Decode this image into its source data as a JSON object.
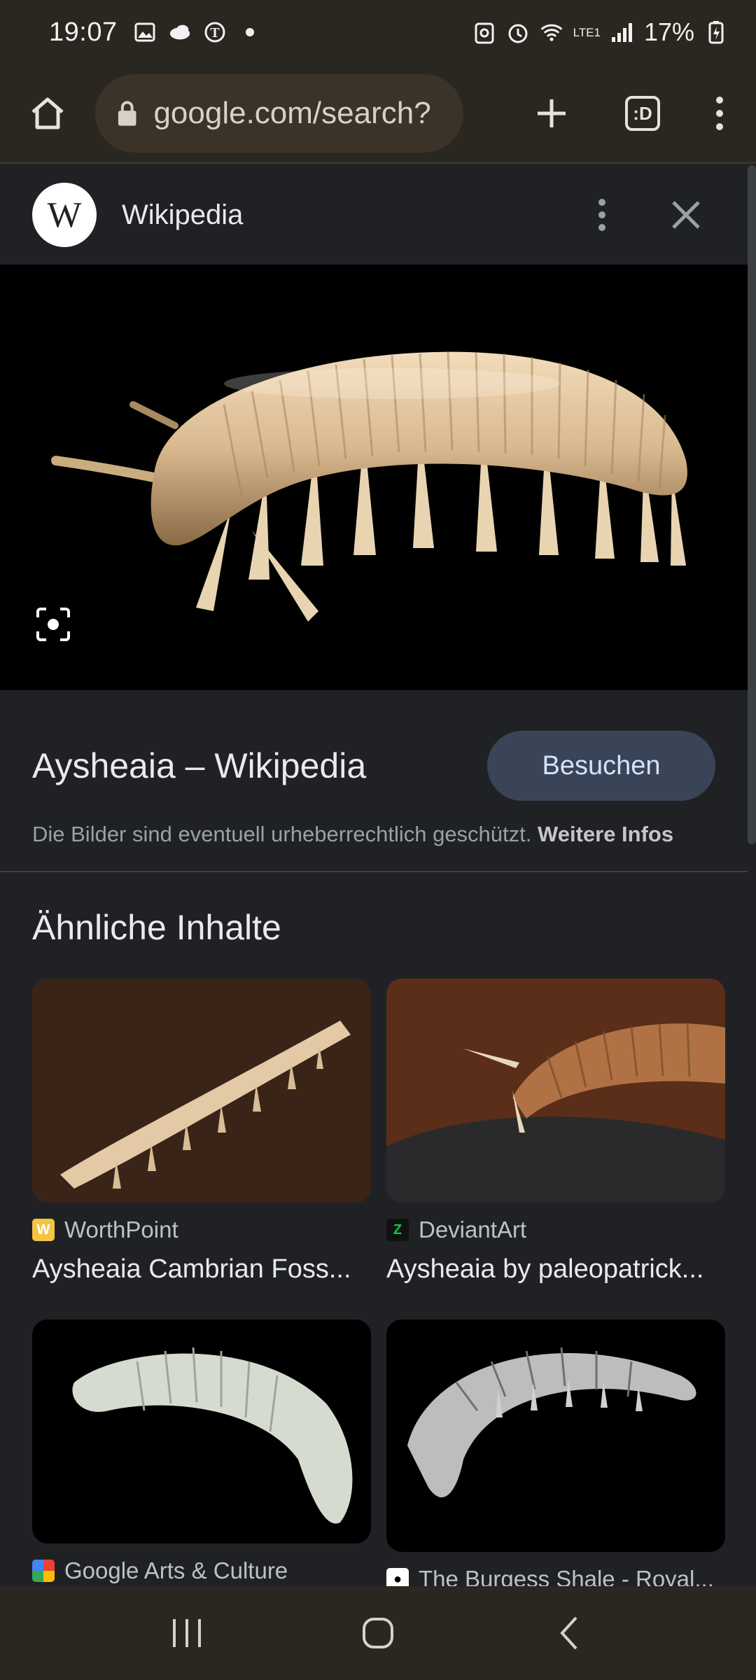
{
  "status_bar": {
    "time": "19:07",
    "battery": "17%",
    "network": "LTE1"
  },
  "browser": {
    "url": "google.com/search?",
    "tab_count": ":D"
  },
  "panel": {
    "source_name": "Wikipedia",
    "wiki_letter": "W",
    "result_title": "Aysheaia – Wikipedia",
    "visit_button": "Besuchen",
    "copyright_text": "Die Bilder sind eventuell urheberrechtlich geschützt.",
    "more_info": "Weitere Infos",
    "related_heading": "Ähnliche Inhalte",
    "related": [
      {
        "source": "WorthPoint",
        "title": "Aysheaia Cambrian Foss...",
        "favicon_color": "#f4c542"
      },
      {
        "source": "DeviantArt",
        "title": "Aysheaia by paleopatrick...",
        "favicon_color": "#05cc47"
      },
      {
        "source": "Google Arts & Culture",
        "title": "",
        "favicon_color": "#ea4335"
      },
      {
        "source": "The Burgess Shale - Royal...",
        "title": "",
        "favicon_color": "#ffffff"
      }
    ]
  },
  "colors": {
    "system_bar": "#2a2620",
    "panel_bg": "#202124",
    "visit_button_bg": "#394457"
  }
}
